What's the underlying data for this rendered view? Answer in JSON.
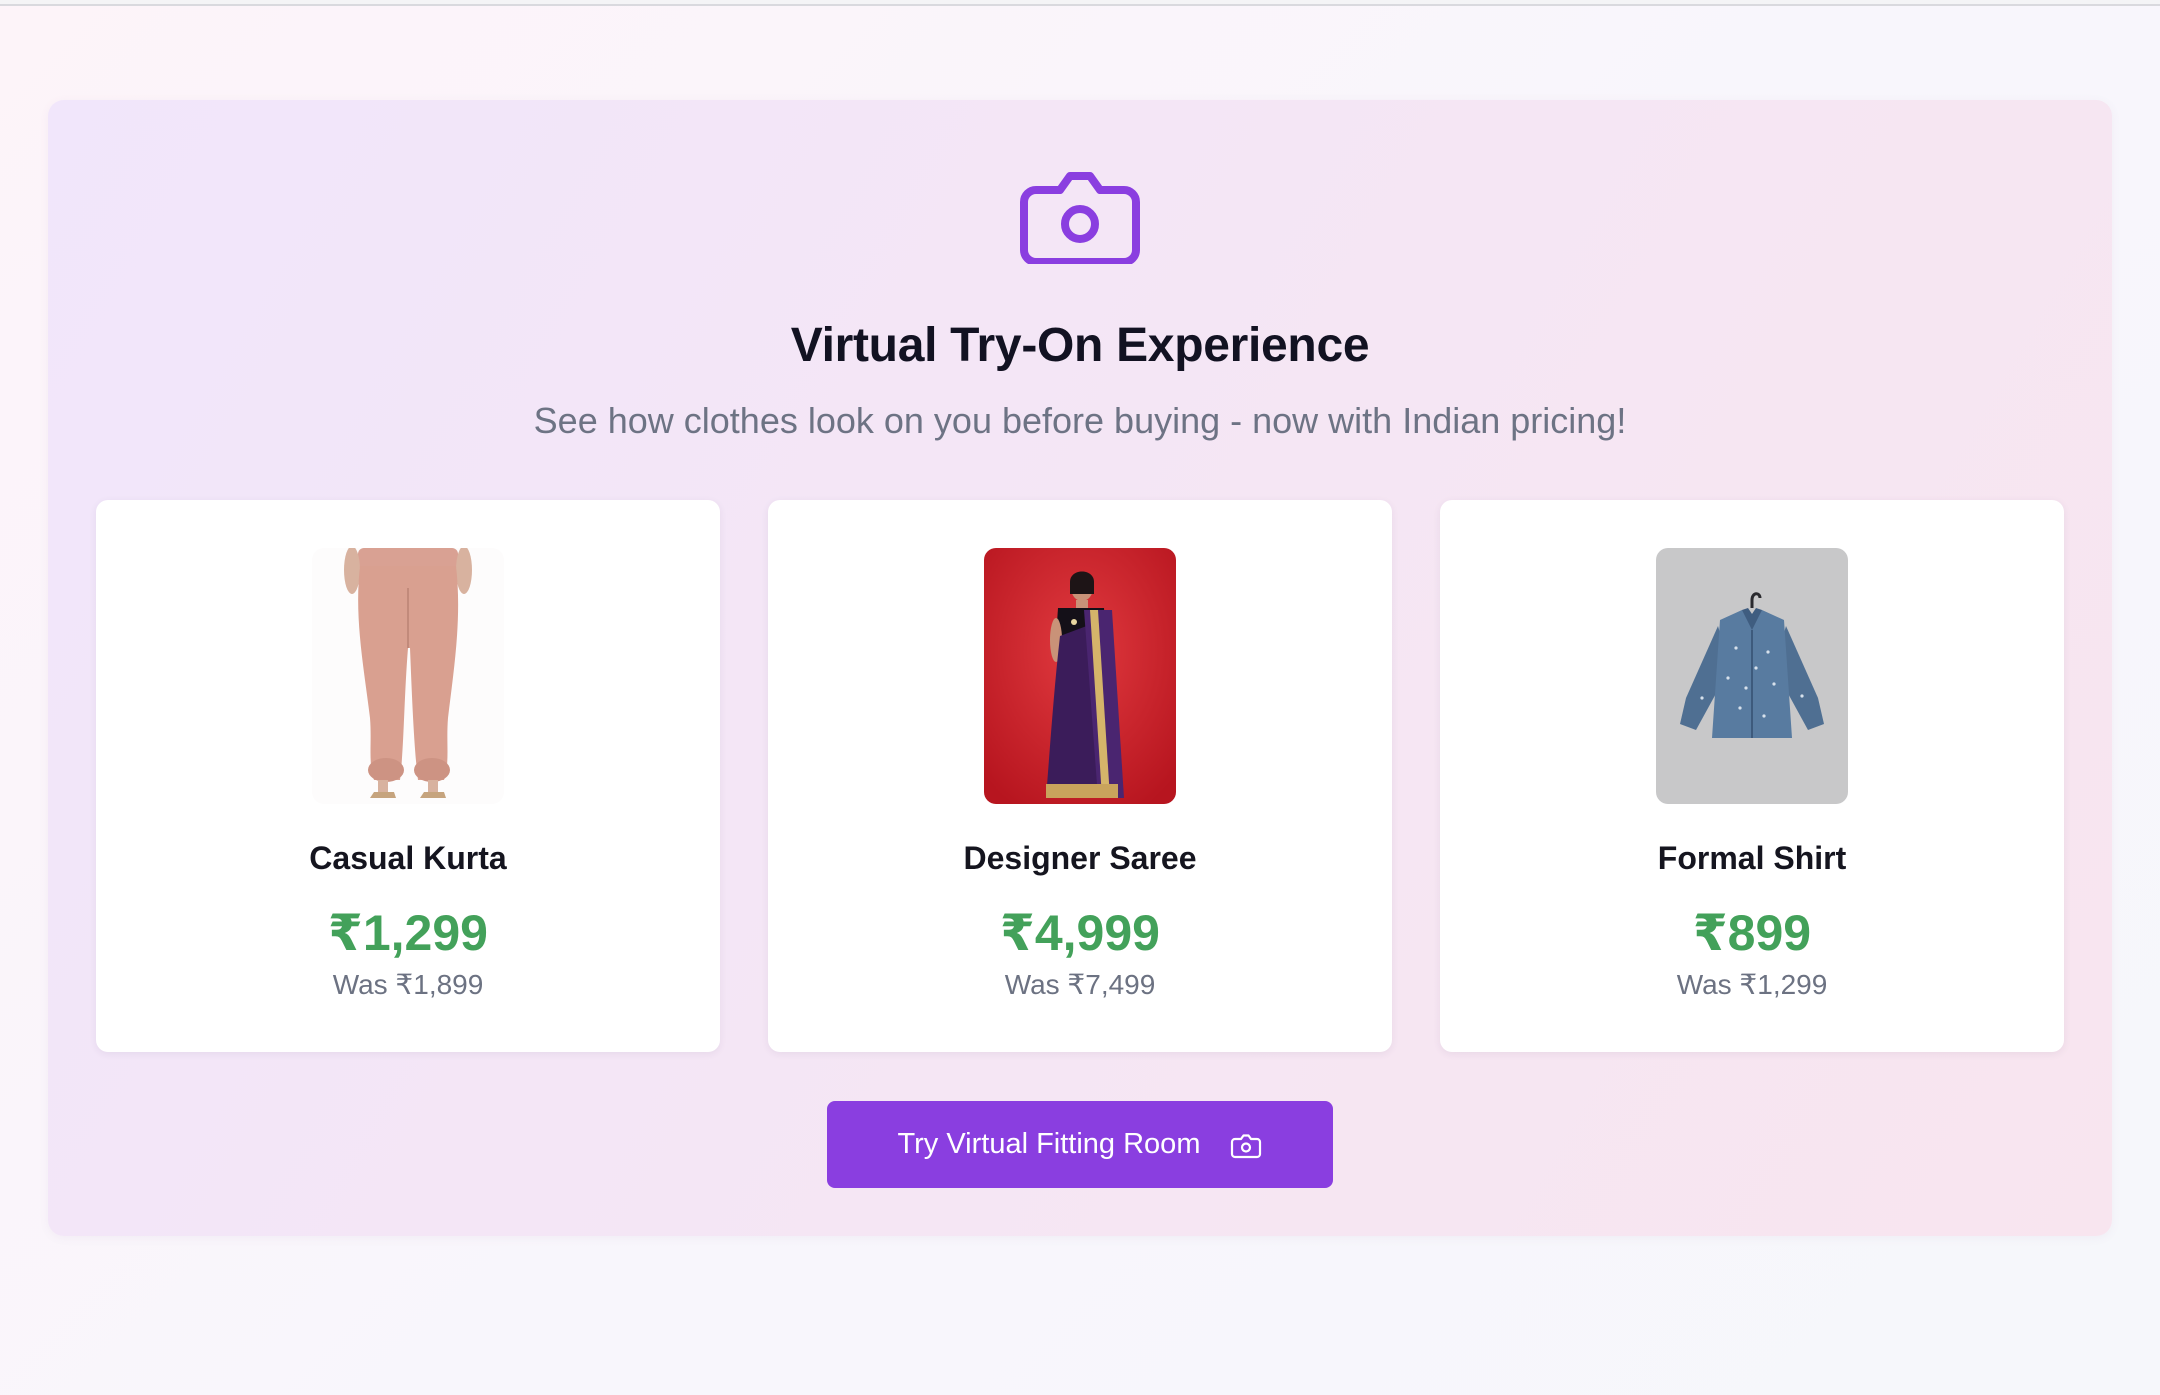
{
  "hero": {
    "icon": "camera-icon",
    "title": "Virtual Try-On Experience",
    "subtitle": "See how clothes look on you before buying - now with Indian pricing!"
  },
  "products": [
    {
      "name": "Casual Kurta",
      "price": "₹1,299",
      "was": "Was ₹1,899",
      "image": "pink-joggers-photo"
    },
    {
      "name": "Designer Saree",
      "price": "₹4,999",
      "was": "Was ₹7,499",
      "image": "purple-saree-photo"
    },
    {
      "name": "Formal Shirt",
      "price": "₹899",
      "was": "Was ₹1,299",
      "image": "blue-shirt-photo"
    }
  ],
  "cta": {
    "label": "Try Virtual Fitting Room",
    "icon": "camera-icon"
  },
  "colors": {
    "accent": "#8a3ee0",
    "icon_purple": "#8a3ee0",
    "price_green": "#43a15a",
    "panel_start": "#f1e6fb",
    "panel_end": "#f8e5ef"
  }
}
